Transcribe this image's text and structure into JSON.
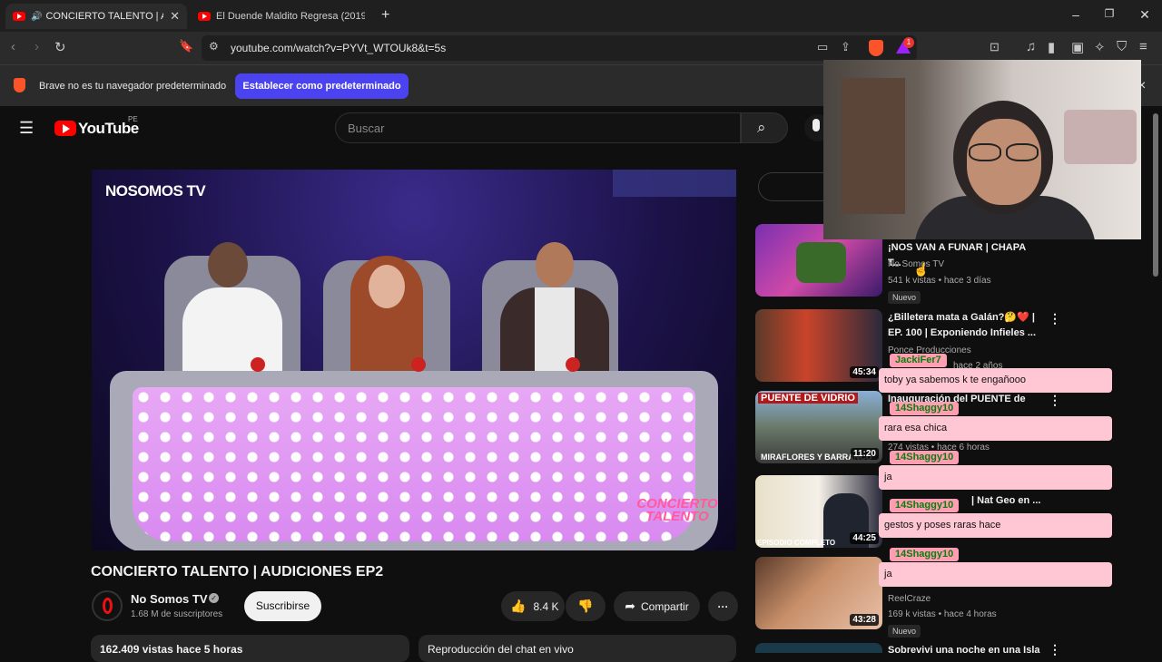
{
  "browser": {
    "tabs": [
      {
        "title": "CONCIERTO TALENTO | AUDIC",
        "active": true
      },
      {
        "title": "El Duende Maldito Regresa (2019) Tr",
        "active": false
      }
    ],
    "new_tab": "+",
    "url": "youtube.com/watch?v=PYVt_WTOUk8&t=5s",
    "brave_badge": "1",
    "infobar_text": "Brave no es tu navegador predeterminado",
    "infobar_button": "Establecer como predeterminado",
    "infobar_close": "×"
  },
  "youtube": {
    "logo_text": "YouTube",
    "region": "PE",
    "search_placeholder": "Buscar",
    "video": {
      "channel_watermark": "NOSOMOS TV",
      "overlay_logo": "CONCIERTO TALENTO",
      "title": "CONCIERTO TALENTO | AUDICIONES EP2"
    },
    "channel": {
      "name": "No Somos TV",
      "subscribers": "1.68 M de suscriptores",
      "subscribe_label": "Suscribirse"
    },
    "actions": {
      "likes": "8.4 K",
      "share": "Compartir",
      "more": "···"
    },
    "description_peek": "162.409 vistas  hace 5 horas",
    "chat_replay": "Reproducción del chat en vivo",
    "recommended": [
      {
        "title": "¡NOS VAN A FUNAR | CHAPA T...",
        "channel": "No Somos TV",
        "meta": "541 k vistas • hace 3 días",
        "badge": "Nuevo"
      },
      {
        "title": "¿Billetera mata a Galán?🤔❤️ | EP. 100 | Exponiendo Infieles ...",
        "channel": "Ponce Producciones",
        "meta": "hace 2 años",
        "duration": "45:34"
      },
      {
        "title": "Inauguración del PUENTE de",
        "channel": "",
        "meta": "274 vistas • hace 6 horas",
        "duration": "11:20",
        "thumb_text_top": "PUENTE DE VIDRIO",
        "thumb_text_bottom": "MIRAFLORES Y BARRANCO"
      },
      {
        "title": "| Nat Geo en ...",
        "channel": "",
        "meta": "",
        "duration": "44:25",
        "thumb_text_bottom": "EPISODIO COMPLETO"
      },
      {
        "title": "",
        "channel": "ReelCraze",
        "meta": "169 k vistas • hace 4 horas",
        "duration": "43:28",
        "badge": "Nuevo"
      },
      {
        "title": "Sobrevivi una noche en una Isla",
        "channel": "",
        "meta": ""
      }
    ]
  },
  "chat_overlay": [
    {
      "user": "JackiFer7",
      "message": "toby ya sabemos k te engañooo"
    },
    {
      "user": "14Shaggy10",
      "message": "rara esa chica"
    },
    {
      "user": "14Shaggy10",
      "message": "ja"
    },
    {
      "user": "14Shaggy10",
      "message": "gestos y poses raras hace"
    },
    {
      "user": "14Shaggy10",
      "message": "ja"
    }
  ],
  "colors": {
    "yt_red": "#ff0000",
    "brave_button": "#4b43f0",
    "chat_name_bg": "#ff9db3",
    "chat_msg_bg": "#ffc6d3",
    "chat_name_text": "#0b7d0b"
  }
}
